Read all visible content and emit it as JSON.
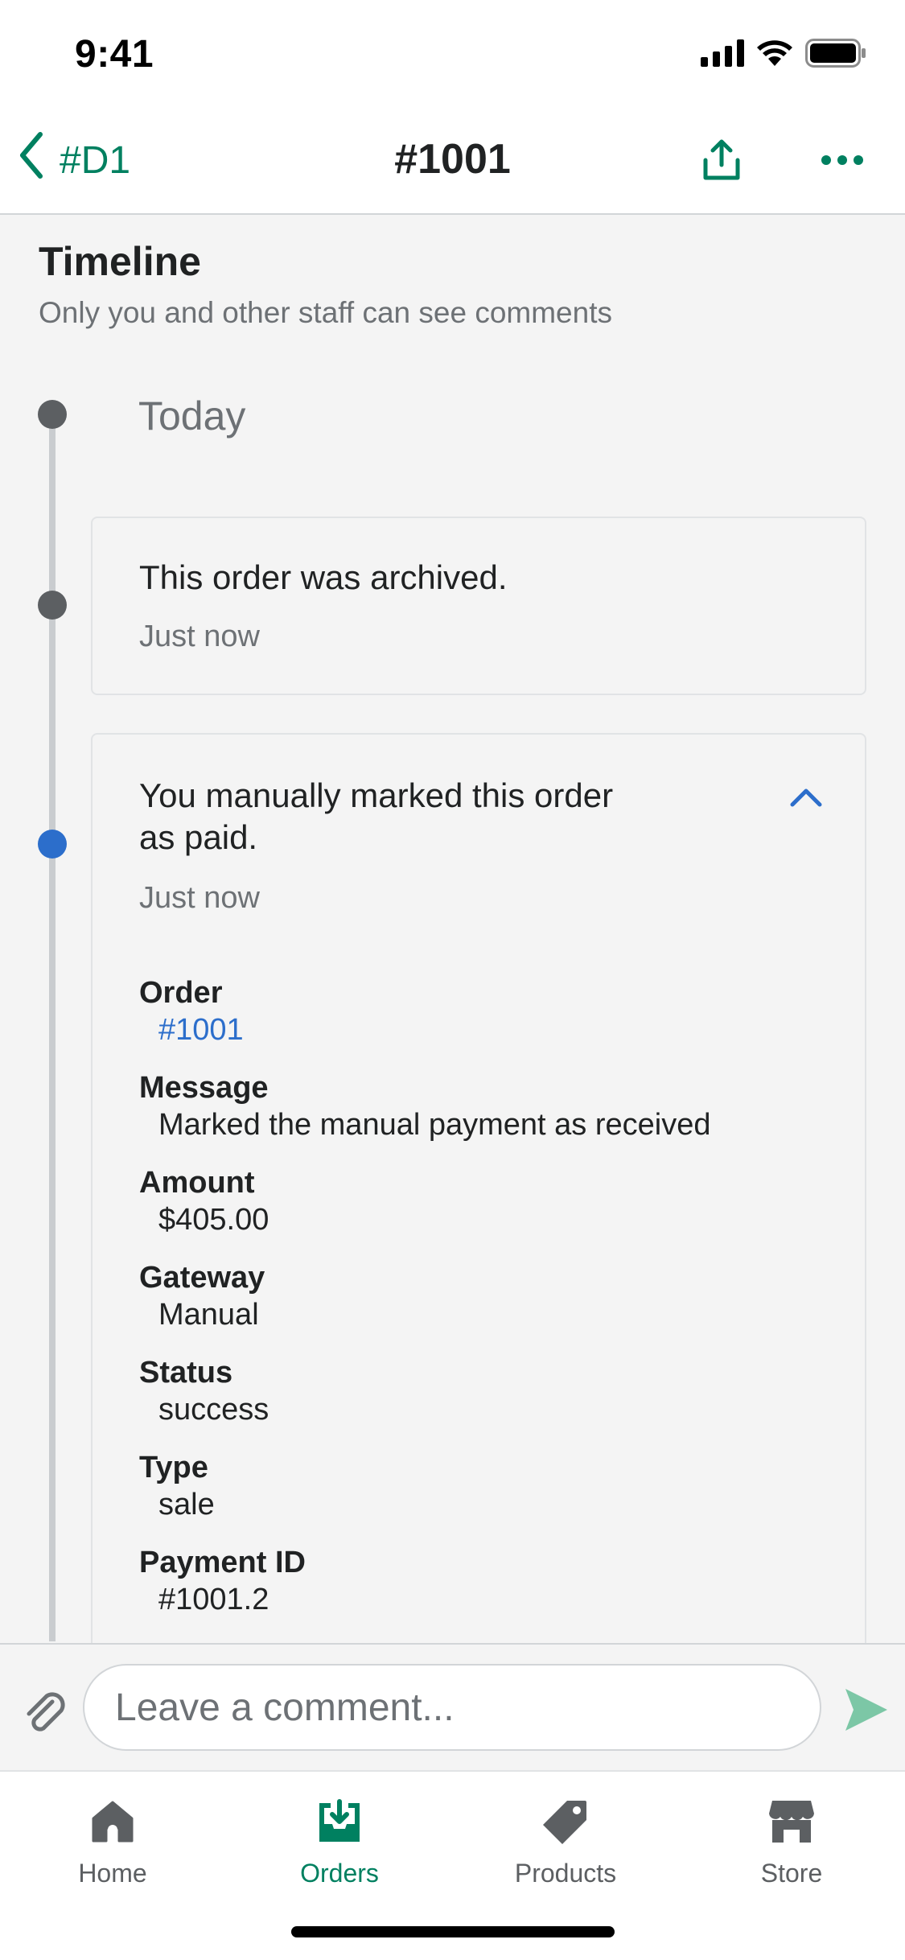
{
  "status_bar": {
    "time": "9:41"
  },
  "nav": {
    "back_label": "#D1",
    "title": "#1001",
    "share_icon": "share-icon",
    "more_icon": "more-icon"
  },
  "timeline": {
    "title": "Timeline",
    "subtitle": "Only you and other staff can see comments",
    "day_label": "Today",
    "events": [
      {
        "text": "This order was archived.",
        "time": "Just now"
      },
      {
        "text_line1": "You manually marked this order",
        "text_line2": "as paid.",
        "time": "Just now",
        "details": {
          "order_label": "Order",
          "order_value": "#1001",
          "message_label": "Message",
          "message_value": "Marked the manual payment as received",
          "amount_label": "Amount",
          "amount_value": "$405.00",
          "gateway_label": "Gateway",
          "gateway_value": "Manual",
          "status_label": "Status",
          "status_value": "success",
          "type_label": "Type",
          "type_value": "sale",
          "payment_id_label": "Payment ID",
          "payment_id_value": "#1001.2"
        }
      }
    ]
  },
  "comment": {
    "placeholder": "Leave a comment..."
  },
  "tabs": [
    {
      "label": "Home",
      "icon": "home-icon"
    },
    {
      "label": "Orders",
      "icon": "orders-icon",
      "active": true
    },
    {
      "label": "Products",
      "icon": "tag-icon"
    },
    {
      "label": "Store",
      "icon": "store-icon"
    }
  ],
  "colors": {
    "accent_green": "#008060",
    "link_blue": "#2c6ecb",
    "timeline_dot": "#5c5f62",
    "background": "#f4f4f4"
  }
}
